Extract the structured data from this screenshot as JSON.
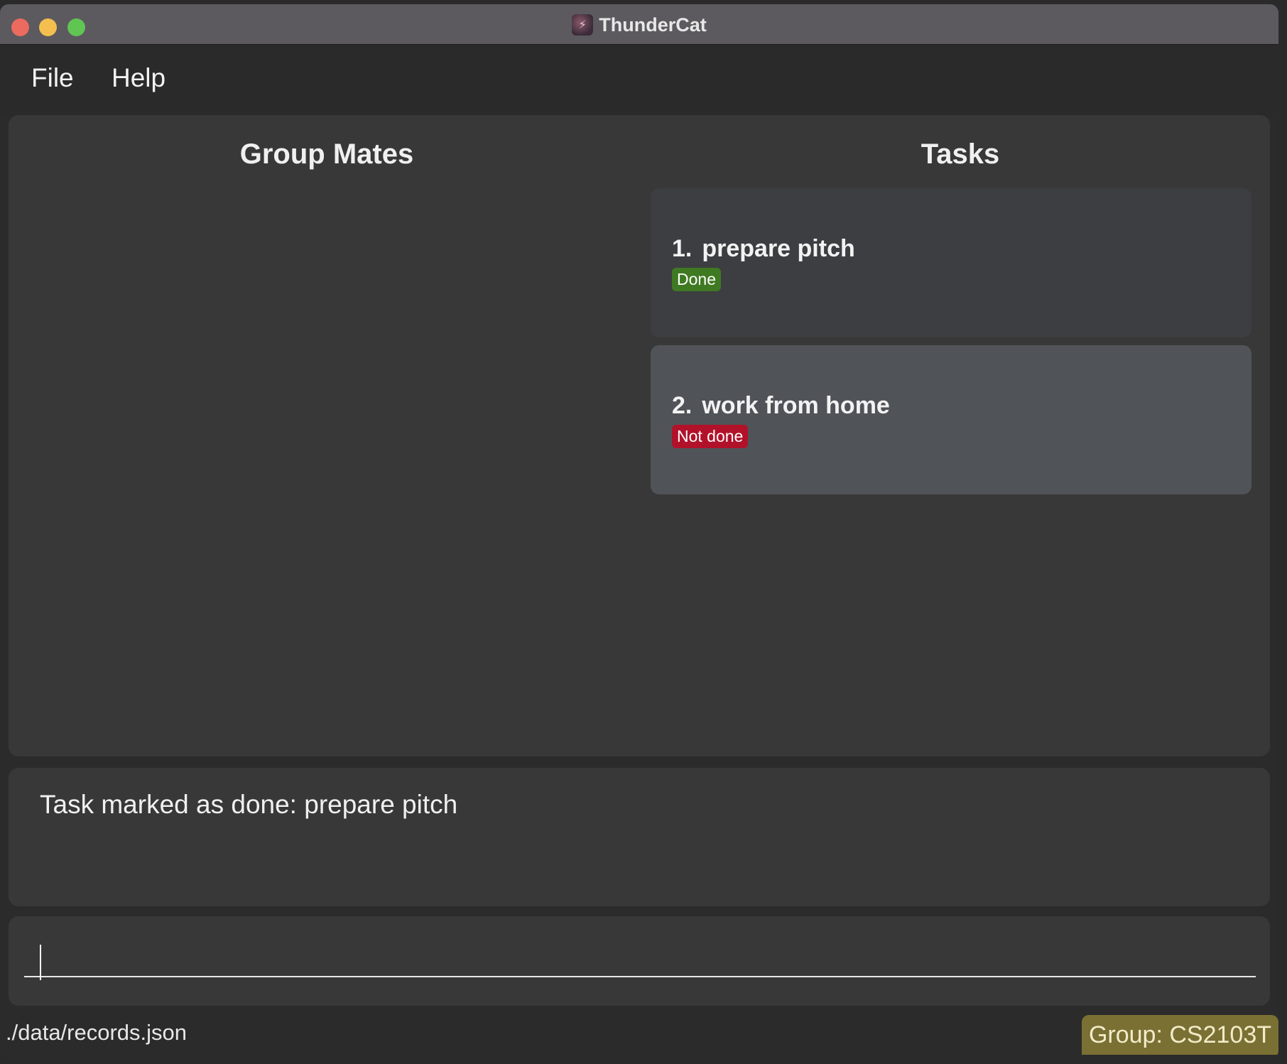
{
  "window": {
    "title": "ThunderCat",
    "app_icon": "thundercat-icon"
  },
  "menu": {
    "items": [
      {
        "label": "File"
      },
      {
        "label": "Help"
      }
    ]
  },
  "group_mates": {
    "title": "Group Mates"
  },
  "tasks": {
    "title": "Tasks",
    "items": [
      {
        "index": "1.",
        "name": "prepare pitch",
        "status": "Done",
        "status_color": "#3f7a22"
      },
      {
        "index": "2.",
        "name": "work from home",
        "status": "Not done",
        "status_color": "#b1122a"
      }
    ]
  },
  "result": {
    "message": "Task marked as done: prepare pitch"
  },
  "command": {
    "value": ""
  },
  "status_bar": {
    "file_path": "./data/records.json",
    "group": "Group: CS2103T"
  }
}
